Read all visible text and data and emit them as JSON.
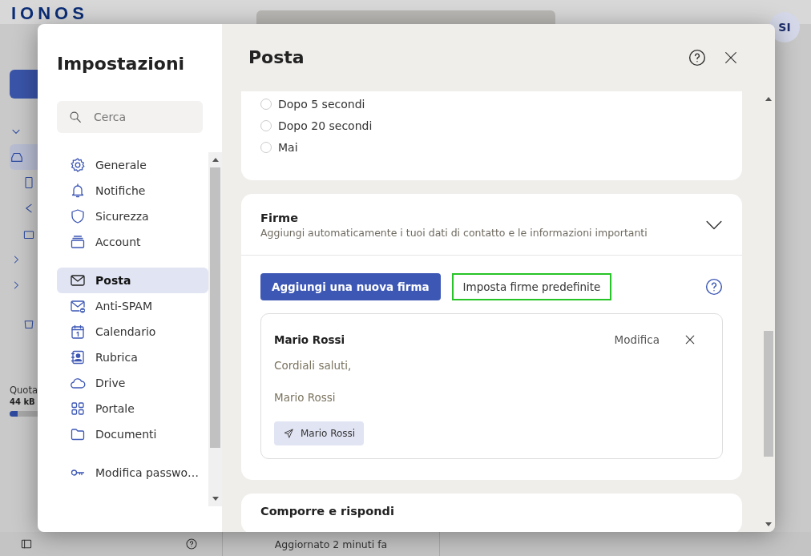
{
  "app": {
    "logo": "IONOS",
    "avatar": "SI",
    "quota_label": "Quota",
    "quota_value": "44 kB",
    "status": "Aggiornato 2 minuti fa"
  },
  "settings": {
    "title": "Impostazioni",
    "search": {
      "placeholder": "Cerca"
    },
    "nav_groups": [
      {
        "items": [
          {
            "label": "Generale",
            "selected": false
          },
          {
            "label": "Notifiche",
            "selected": false
          },
          {
            "label": "Sicurezza",
            "selected": false
          },
          {
            "label": "Account",
            "selected": false
          }
        ]
      },
      {
        "items": [
          {
            "label": "Posta",
            "selected": true
          },
          {
            "label": "Anti-SPAM",
            "selected": false
          },
          {
            "label": "Calendario",
            "selected": false
          },
          {
            "label": "Rubrica",
            "selected": false
          },
          {
            "label": "Drive",
            "selected": false
          },
          {
            "label": "Portale",
            "selected": false
          },
          {
            "label": "Documenti",
            "selected": false
          }
        ]
      },
      {
        "items": [
          {
            "label": "Modifica passwo…",
            "selected": false
          }
        ]
      }
    ]
  },
  "page": {
    "title": "Posta",
    "read_options": [
      {
        "label": "Dopo 5 secondi",
        "selected": false
      },
      {
        "label": "Dopo 20 secondi",
        "selected": false
      },
      {
        "label": "Mai",
        "selected": false
      }
    ],
    "signatures": {
      "title": "Firme",
      "subtitle": "Aggiungi automaticamente i tuoi dati di contatto e le informazioni importanti",
      "expanded": true,
      "add_button": "Aggiungi una nuova firma",
      "defaults_button": {
        "label": "Imposta firme predefinite",
        "focused": true
      },
      "items": [
        {
          "name": "Mario Rossi",
          "edit": "Modifica",
          "lines": [
            "Cordiali saluti,",
            "Mario Rossi"
          ],
          "sender_tag": "Mario Rossi"
        }
      ]
    },
    "next_section": {
      "title": "Comporre e rispondi"
    }
  }
}
